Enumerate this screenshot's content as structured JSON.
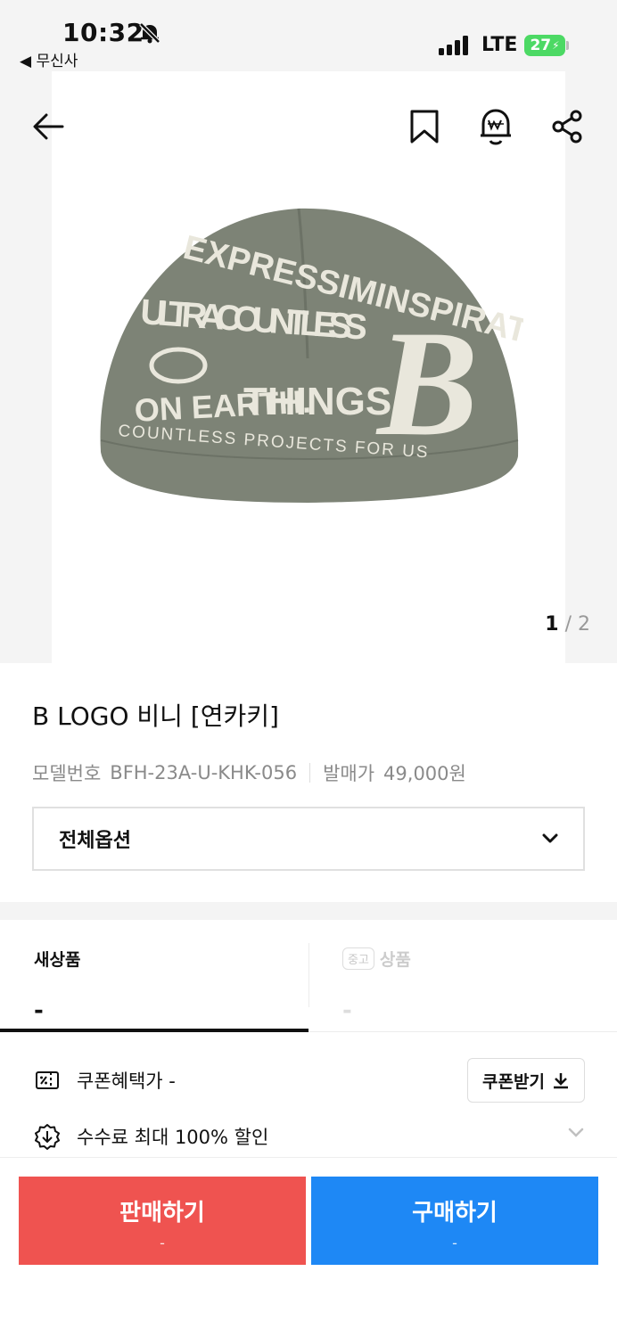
{
  "status_bar": {
    "time": "10:32",
    "back_app": "◀ 무신사",
    "network": "LTE",
    "battery": "27"
  },
  "gallery": {
    "current": "1",
    "separator": " / ",
    "total": "2",
    "image": {
      "rows": [
        {
          "text": "EXPRESSIMINSPIRATION"
        },
        {
          "text": "ULTRACOUNTLESS"
        },
        {
          "text": "THINGS"
        },
        {
          "text": "ON EARTH."
        },
        {
          "text": "COUNTLESS PROJECTS FOR US"
        }
      ],
      "logo_letter": "B"
    }
  },
  "product": {
    "title": "B LOGO 비니 [연카키]",
    "model_label": "모델번호",
    "model_value": "BFH-23A-U-KHK-056",
    "release_label": "발매가",
    "release_value": "49,000원",
    "option_label": "전체옵션"
  },
  "tabs": {
    "new_label": "새상품",
    "new_price": "-",
    "used_chip": "중고",
    "used_label": "상품",
    "used_price": "-"
  },
  "coupon": {
    "label": "쿠폰혜택가 -",
    "button": "쿠폰받기"
  },
  "fee": {
    "label": "수수료 최대 100% 할인"
  },
  "actions": {
    "sell_label": "판매하기",
    "sell_sub": "-",
    "buy_label": "구매하기",
    "buy_sub": "-"
  },
  "colors": {
    "sell": "#ef5350",
    "buy": "#1e88f5",
    "beanie": "#7d8376",
    "beanie_text": "#e9e7dc",
    "battery": "#4cd964"
  }
}
